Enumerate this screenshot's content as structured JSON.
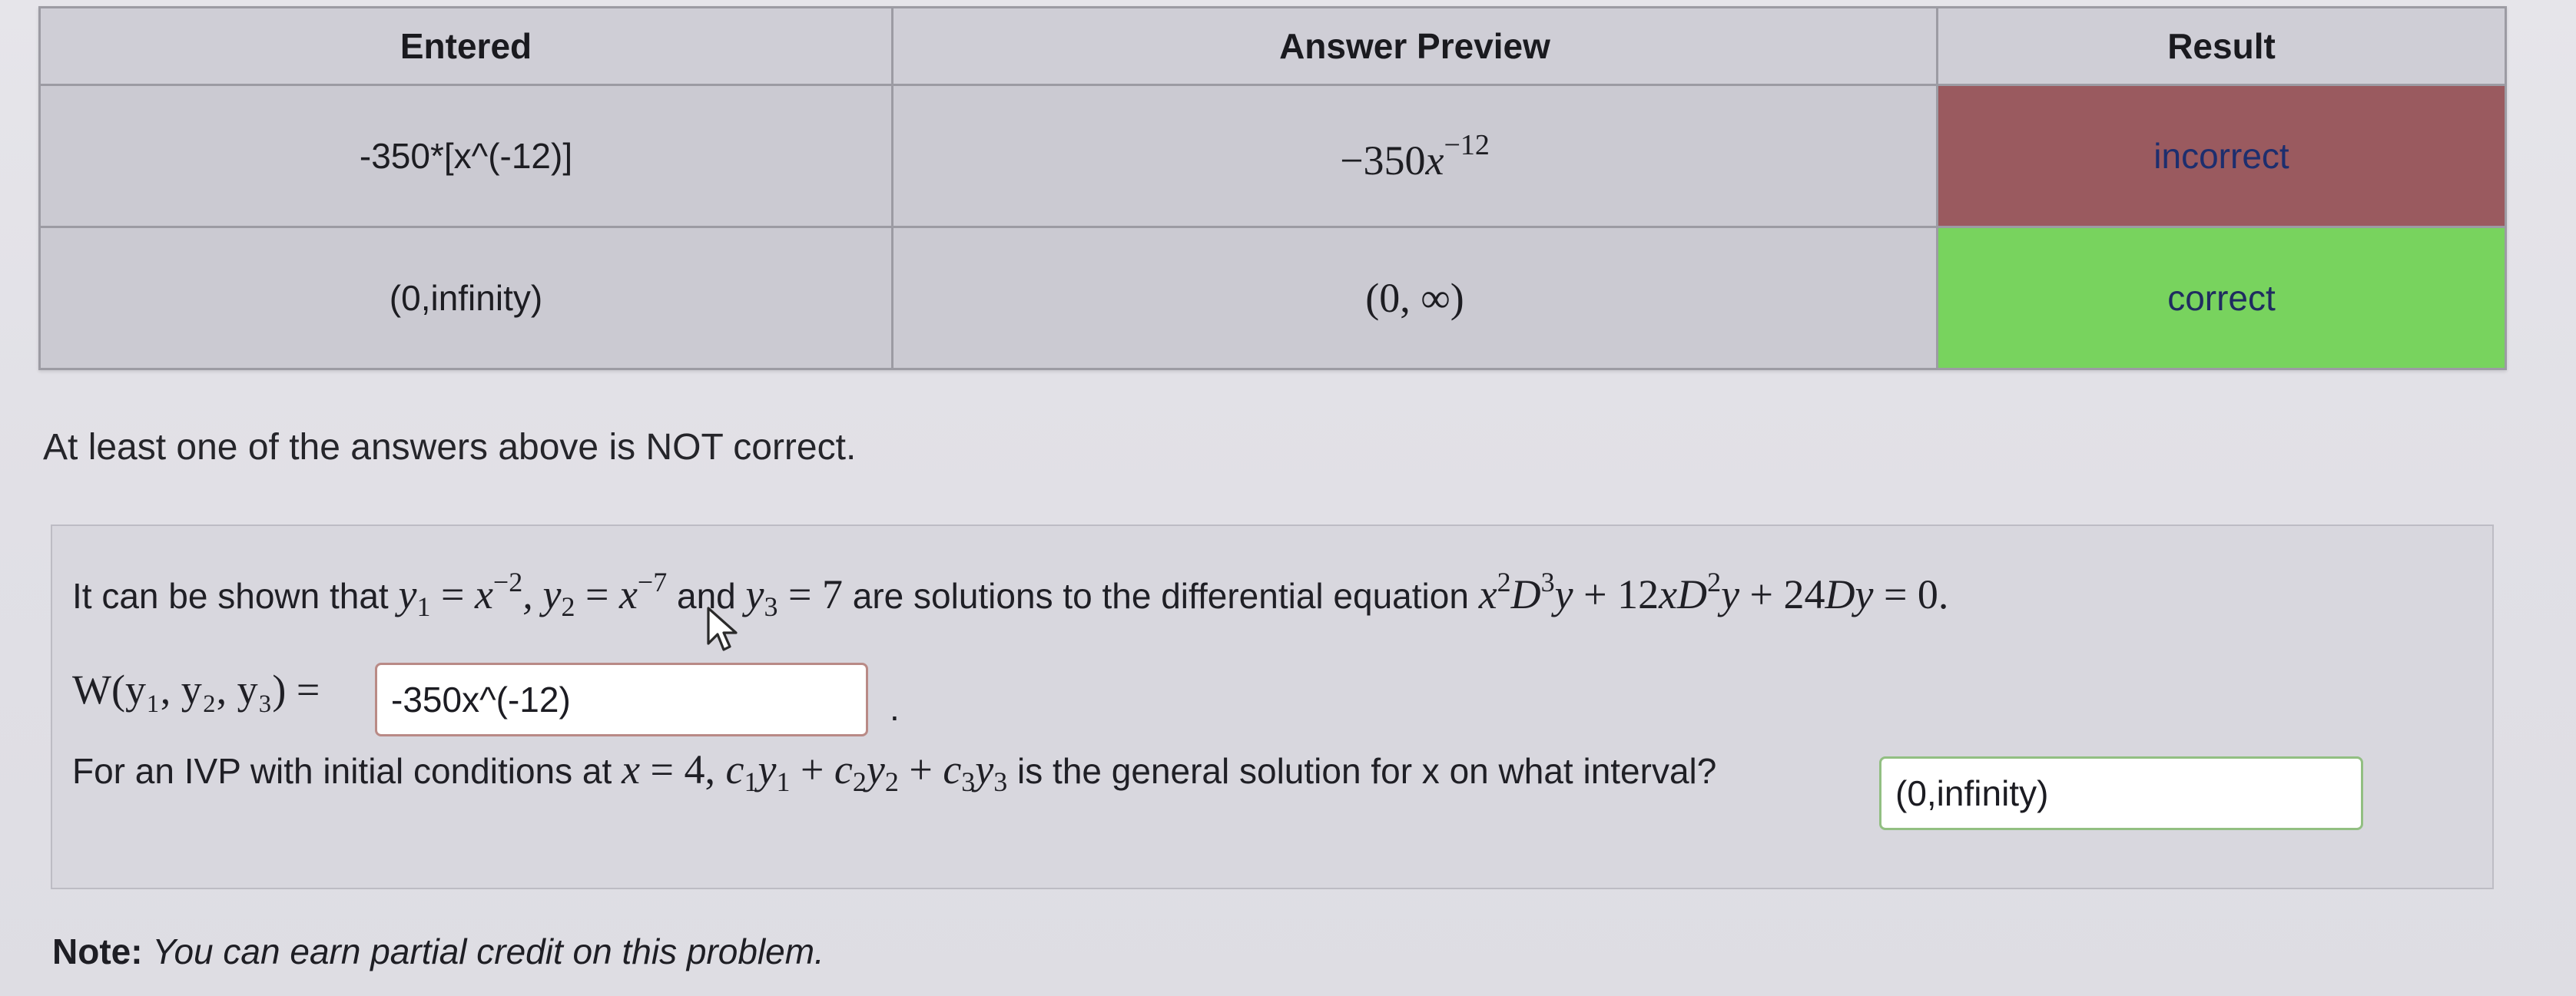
{
  "table": {
    "headers": [
      "Entered",
      "Answer Preview",
      "Result"
    ],
    "rows": [
      {
        "entered": "-350*[x^(-12)]",
        "preview_coef": "−350",
        "preview_var": "x",
        "preview_exp": "−12",
        "result": "incorrect"
      },
      {
        "entered": "(0,infinity)",
        "preview": "(0, ∞)",
        "result": "correct"
      }
    ]
  },
  "colors": {
    "incorrect": "#9a5a5f",
    "correct": "#78d35e"
  },
  "status_message": "At least one of the answers above is NOT correct.",
  "problem": {
    "intro_prefix": "It can be shown that",
    "and_text": "and",
    "solutions_text": "are solutions to the differential equation",
    "wronskian_label": "W(y₁, y₂, y₃) =",
    "wronskian_value": "-350x^(-12)",
    "ivp_prefix": "For an IVP with initial conditions at",
    "ivp_suffix": "is the general solution for x on what interval?",
    "interval_value": "(0,infinity)"
  },
  "note": {
    "label": "Note:",
    "text": "You can earn partial credit on this problem."
  },
  "icons": [
    "mouse-pointer-icon"
  ]
}
